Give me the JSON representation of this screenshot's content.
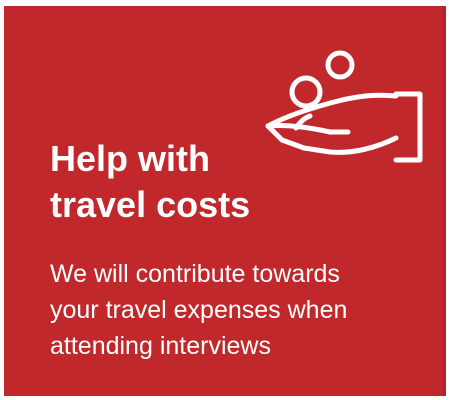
{
  "card": {
    "background_color": "#c0282c",
    "text_color": "#ffffff",
    "icon": "hand-holding-coins-icon",
    "title_line1": "Help with",
    "title_line2": "travel costs",
    "body_line1": "We will contribute towards",
    "body_line2": "your travel expenses when",
    "body_line3": "attending interviews"
  }
}
